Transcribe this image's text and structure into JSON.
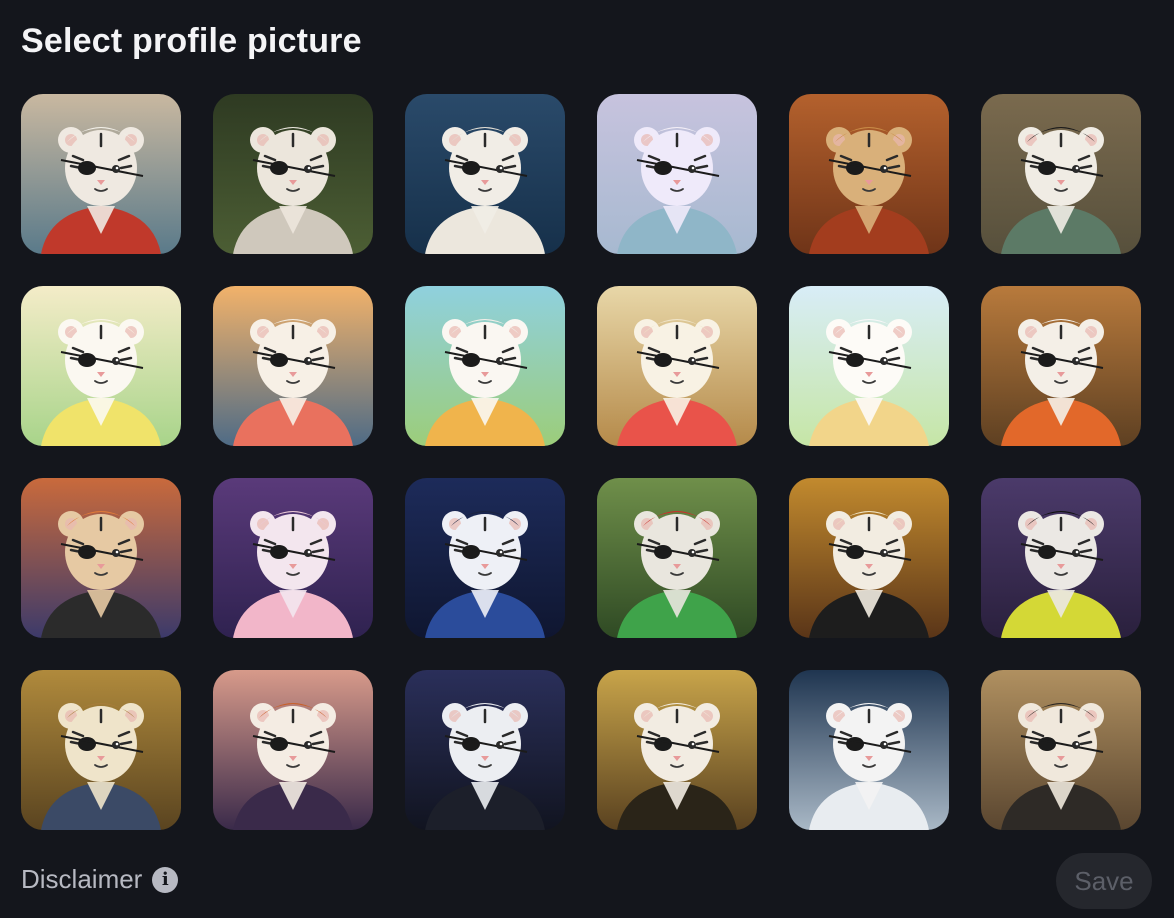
{
  "dialog": {
    "title": "Select profile picture",
    "disclaimer_label": "Disclaimer",
    "save_label": "Save",
    "info_icon": "info-icon"
  },
  "avatars": [
    {
      "bg1": "#c9b8a0",
      "bg2": "#5a7a8a",
      "fur": "#efe9e1",
      "accent": "#c0392b",
      "hair": "#f2efe8"
    },
    {
      "bg1": "#2e3a22",
      "bg2": "#4c5e34",
      "fur": "#ece6dc",
      "accent": "#cfc8bc",
      "hair": "#e8e4dc"
    },
    {
      "bg1": "#2a4a6a",
      "bg2": "#16304a",
      "fur": "#f1ede6",
      "accent": "#ece7dd",
      "hair": "#e0ddd4"
    },
    {
      "bg1": "#c7c3de",
      "bg2": "#a7b9d0",
      "fur": "#efeafa",
      "accent": "#8fb6c8",
      "hair": "#f3eef7"
    },
    {
      "bg1": "#b4612d",
      "bg2": "#6f3418",
      "fur": "#d9b07a",
      "accent": "#a33d1e",
      "hair": "#c88a46"
    },
    {
      "bg1": "#7a6a4e",
      "bg2": "#57503c",
      "fur": "#f0ece4",
      "accent": "#5c7a66",
      "hair": "#1a1a1a"
    },
    {
      "bg1": "#f4ecc8",
      "bg2": "#a8d48a",
      "fur": "#fbf8f1",
      "accent": "#f0e36a",
      "hair": "#fbf6e8"
    },
    {
      "bg1": "#f2b26a",
      "bg2": "#4e6b86",
      "fur": "#f7f0e6",
      "accent": "#e9715e",
      "hair": "#f4ede2"
    },
    {
      "bg1": "#8fd0de",
      "bg2": "#9ccd7a",
      "fur": "#faf7f2",
      "accent": "#f0b44c",
      "hair": "#f2efe9"
    },
    {
      "bg1": "#e8d7a8",
      "bg2": "#b58a4a",
      "fur": "#f8f2e4",
      "accent": "#e9534a",
      "hair": "#efe4c8"
    },
    {
      "bg1": "#d8edf7",
      "bg2": "#c6e6a6",
      "fur": "#fdfbf7",
      "accent": "#f2d58a",
      "hair": "#f8f8f8"
    },
    {
      "bg1": "#b87a3c",
      "bg2": "#5e4022",
      "fur": "#f4efe7",
      "accent": "#e2682a",
      "hair": "#f2eee8"
    },
    {
      "bg1": "#c96a3c",
      "bg2": "#3c3a6a",
      "fur": "#e6c9a3",
      "accent": "#2b2b2b",
      "hair": "#e07a3a"
    },
    {
      "bg1": "#5a3a7a",
      "bg2": "#2f2250",
      "fur": "#f3e6ee",
      "accent": "#f2b6c9",
      "hair": "#eac9d6"
    },
    {
      "bg1": "#1d2b5a",
      "bg2": "#0f1630",
      "fur": "#eef0f6",
      "accent": "#2b4c9b",
      "hair": "#1a2340"
    },
    {
      "bg1": "#6f8f4a",
      "bg2": "#2f4a24",
      "fur": "#e9e6de",
      "accent": "#3fa34a",
      "hair": "#c8322c"
    },
    {
      "bg1": "#c28a2e",
      "bg2": "#5a3518",
      "fur": "#f2ece1",
      "accent": "#1d1d1d",
      "hair": "#f0e4c4"
    },
    {
      "bg1": "#4b3a6a",
      "bg2": "#2a203d",
      "fur": "#ebe8e4",
      "accent": "#d4d836",
      "hair": "#111111"
    },
    {
      "bg1": "#b08a3c",
      "bg2": "#5a4420",
      "fur": "#efe4ca",
      "accent": "#3b4a66",
      "hair": "#a67c3a"
    },
    {
      "bg1": "#d79a8a",
      "bg2": "#3a2a4a",
      "fur": "#f4ece3",
      "accent": "#3a2a4a",
      "hair": "#c8602a"
    },
    {
      "bg1": "#2a2f5a",
      "bg2": "#111420",
      "fur": "#eceef2",
      "accent": "#1c1f2a",
      "hair": "#e8eaee"
    },
    {
      "bg1": "#c8a44a",
      "bg2": "#5a4220",
      "fur": "#f2ece2",
      "accent": "#2a2418",
      "hair": "#f0e8da"
    },
    {
      "bg1": "#1f3550",
      "bg2": "#a9b8c6",
      "fur": "#f3f3f3",
      "accent": "#e8ecf0",
      "hair": "#f4f4f4"
    },
    {
      "bg1": "#b09060",
      "bg2": "#5a4630",
      "fur": "#f0e8dc",
      "accent": "#2e2a26",
      "hair": "#2a2622"
    }
  ]
}
